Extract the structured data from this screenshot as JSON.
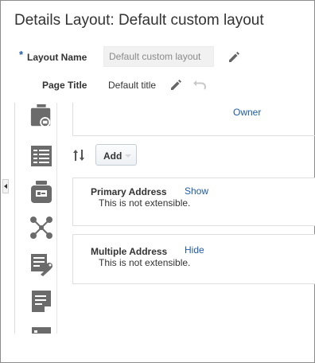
{
  "page": {
    "title": "Details Layout: Default custom layout"
  },
  "form": {
    "required_marker": "*",
    "layout_name_label": "Layout Name",
    "layout_name_value": "Default custom layout",
    "page_title_label": "Page Title",
    "page_title_value": "Default title"
  },
  "palette": {
    "icons": [
      "briefcase-icon",
      "table-grid-icon",
      "id-card-icon",
      "network-nodes-icon",
      "settings-tools-icon",
      "document-icon"
    ]
  },
  "layout": {
    "owner_link": "Owner",
    "add_button": "Add",
    "cards": [
      {
        "title": "Primary Address",
        "action": "Show",
        "description": "This is not extensible."
      },
      {
        "title": "Multiple Address",
        "action": "Hide",
        "description": "This is not extensible."
      }
    ]
  },
  "colors": {
    "link": "#1f5ba8",
    "icon_gray": "#6b6b6b",
    "input_bg": "#f1f1f1"
  }
}
